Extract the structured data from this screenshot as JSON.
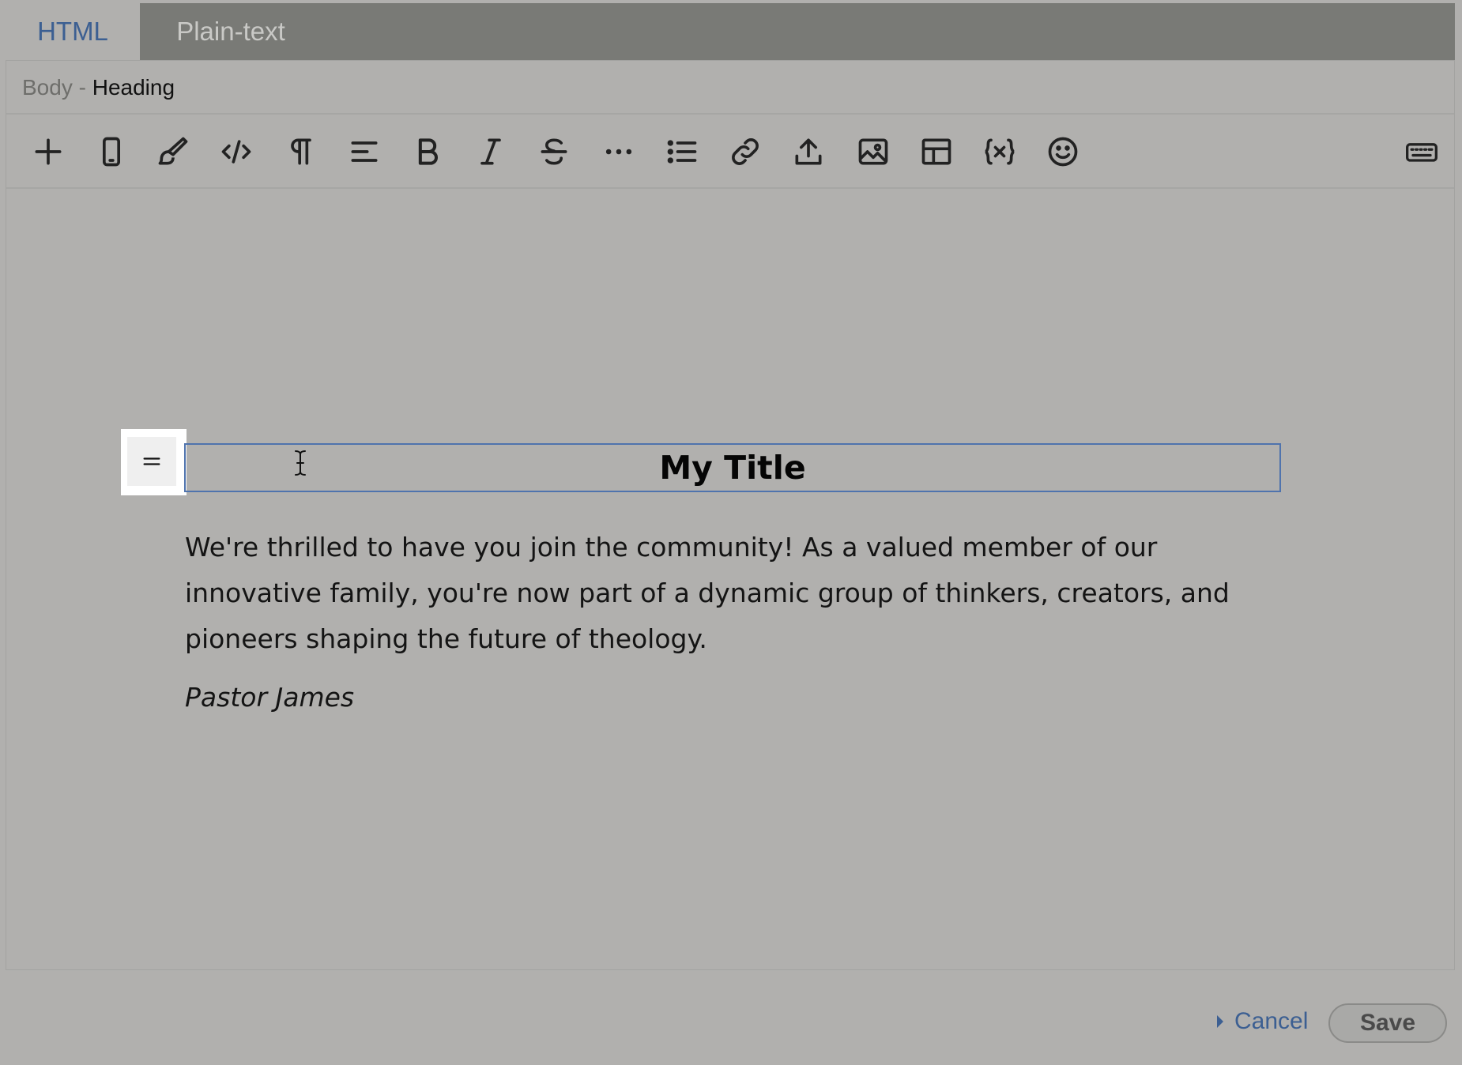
{
  "tabs": [
    {
      "label": "HTML",
      "active": true
    },
    {
      "label": "Plain-text",
      "active": false
    }
  ],
  "breadcrumb": {
    "root": "Body",
    "separator": " - ",
    "current": "Heading"
  },
  "toolbar": {
    "tools": [
      {
        "name": "add",
        "icon": "plus-icon"
      },
      {
        "name": "mobile-preview",
        "icon": "mobile-icon"
      },
      {
        "name": "style",
        "icon": "paintbrush-icon"
      },
      {
        "name": "source-code",
        "icon": "code-icon"
      },
      {
        "name": "paragraph",
        "icon": "pilcrow-icon"
      },
      {
        "name": "align",
        "icon": "align-left-icon"
      },
      {
        "name": "bold",
        "icon": "bold-icon"
      },
      {
        "name": "italic",
        "icon": "italic-icon"
      },
      {
        "name": "strikethrough",
        "icon": "strikethrough-icon"
      },
      {
        "name": "more",
        "icon": "ellipsis-icon"
      },
      {
        "name": "list",
        "icon": "bulleted-list-icon"
      },
      {
        "name": "link",
        "icon": "link-icon"
      },
      {
        "name": "upload",
        "icon": "upload-icon"
      },
      {
        "name": "image",
        "icon": "image-icon"
      },
      {
        "name": "table",
        "icon": "table-icon"
      },
      {
        "name": "variable",
        "icon": "variable-icon"
      },
      {
        "name": "emoji",
        "icon": "emoji-icon"
      }
    ],
    "right_tool": {
      "name": "keyboard-shortcuts",
      "icon": "keyboard-icon"
    }
  },
  "content": {
    "heading": "My Title",
    "paragraph": "We're thrilled to have you join the community! As a valued member of our innovative family, you're now part of a dynamic group of thinkers, creators, and pioneers shaping the future of theology.",
    "signature": "Pastor James"
  },
  "footer": {
    "cancel_label": "Cancel",
    "save_label": "Save"
  },
  "colors": {
    "accent": "#3c5f92",
    "selection_border": "#4f73ad",
    "background": "#b1b0ae",
    "tab_bar": "#797a76"
  }
}
